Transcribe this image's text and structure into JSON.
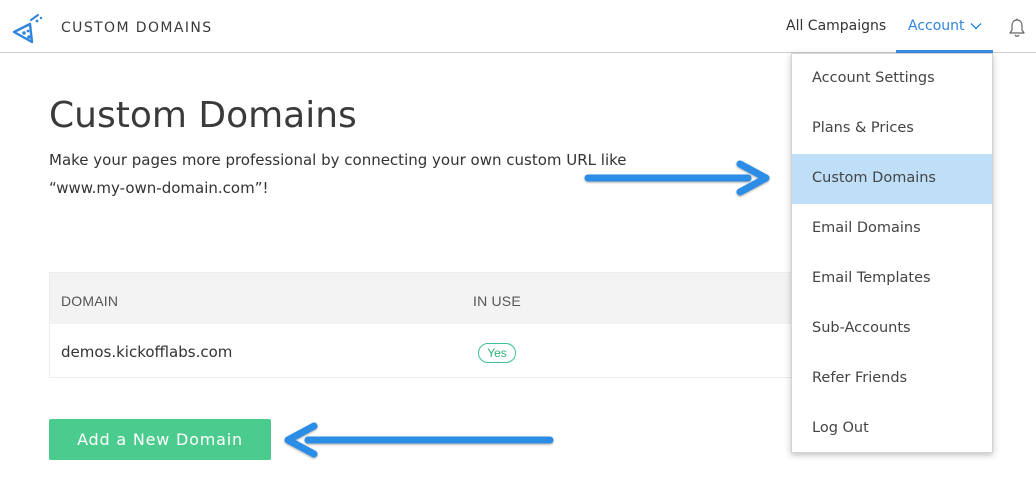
{
  "header": {
    "app_title": "CUSTOM DOMAINS",
    "nav_campaigns": "All Campaigns",
    "nav_account": "Account"
  },
  "main": {
    "title": "Custom Domains",
    "description": "Make your pages more professional by connecting your own custom URL like “www.my-own-domain.com”!"
  },
  "table": {
    "headers": [
      "DOMAIN",
      "IN USE"
    ],
    "rows": [
      {
        "domain": "demos.kickofflabs.com",
        "in_use": "Yes"
      }
    ]
  },
  "add_button": "Add a New Domain",
  "account_menu": {
    "items": [
      {
        "label": "Account Settings",
        "active": false
      },
      {
        "label": "Plans & Prices",
        "active": false
      },
      {
        "label": "Custom Domains",
        "active": true
      },
      {
        "label": "Email Domains",
        "active": false
      },
      {
        "label": "Email Templates",
        "active": false
      },
      {
        "label": "Sub-Accounts",
        "active": false
      },
      {
        "label": "Refer Friends",
        "active": false
      },
      {
        "label": "Log Out",
        "active": false
      }
    ]
  },
  "icons": {
    "logo": "flask-logo-icon",
    "chevron": "chevron-down-icon",
    "bell": "bell-icon",
    "annotation": "arrow-icon"
  },
  "colors": {
    "accent": "#2f86dc",
    "primary_button": "#4ccb8f",
    "active_menu": "#bfdff8",
    "annotation_arrow": "#2b8de6"
  }
}
